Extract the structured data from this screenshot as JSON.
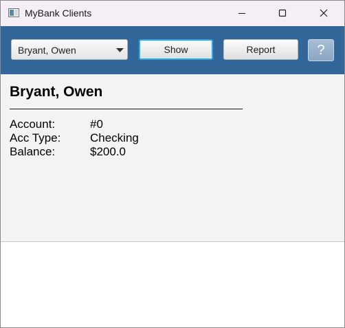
{
  "window": {
    "title": "MyBank Clients"
  },
  "toolbar": {
    "client_select": {
      "selected": "Bryant, Owen"
    },
    "show_label": "Show",
    "report_label": "Report",
    "help_label": "?"
  },
  "details": {
    "client_name": "Bryant, Owen",
    "rows": [
      {
        "label": "Account:",
        "value": "#0"
      },
      {
        "label": "Acc Type:",
        "value": "Checking"
      },
      {
        "label": "Balance:",
        "value": "$200.0"
      }
    ]
  },
  "colors": {
    "toolbar_bg": "#336699",
    "titlebar_bg": "#f6eef6",
    "details_bg": "#f3f3f3",
    "focus_ring": "#30a8e6"
  },
  "icons": {
    "app": "window-app-icon",
    "minimize": "minimize-icon",
    "maximize": "maximize-icon",
    "close": "close-icon",
    "dropdown": "chevron-down-icon"
  }
}
